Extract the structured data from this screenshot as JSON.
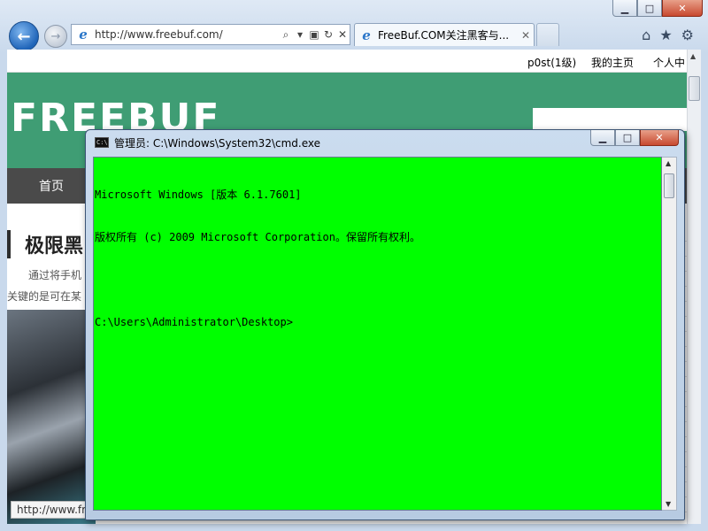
{
  "browser": {
    "address": "http://www.freebuf.com/",
    "tab_title": "FreeBuf.COM关注黑客与...",
    "tab_close": "✕",
    "caption_buttons": {
      "minimize": "▁",
      "maximize": "□",
      "close": "✕"
    },
    "nav": {
      "back": "←",
      "forward": "→"
    },
    "address_icons": {
      "search": "⌕",
      "dropdown": "▾",
      "compat": "▣",
      "refresh": "↻",
      "stop": "✕"
    },
    "tools": {
      "home": "⌂",
      "favorites": "★",
      "settings": "⚙"
    }
  },
  "page": {
    "user_bar": {
      "username": "p0st(1级)",
      "my_home": "我的主页",
      "personal": "个人中"
    },
    "logo": "FREEBUF",
    "nav_home": "首页",
    "article_title": "极限黑",
    "article_desc_1": "通过将手机",
    "article_desc_2": "关键的是可在某",
    "status_url": "http://www.fre"
  },
  "cmd": {
    "title": "管理员: C:\\Windows\\System32\\cmd.exe",
    "icon_text": "C:\\",
    "caption_buttons": {
      "minimize": "▁",
      "maximize": "□",
      "close": "✕"
    },
    "lines": [
      "Microsoft Windows [版本 6.1.7601]",
      "版权所有 (c) 2009 Microsoft Corporation。保留所有权利。",
      "",
      "C:\\Users\\Administrator\\Desktop>"
    ],
    "background_color": "#00ff00",
    "text_color": "#000000"
  }
}
